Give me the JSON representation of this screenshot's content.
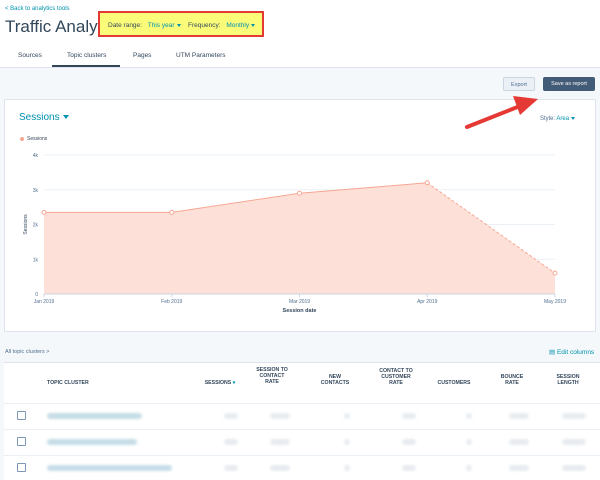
{
  "header": {
    "back_link": "< Back to analytics tools",
    "title": "Traffic Analytics",
    "date_range_label": "Date range:",
    "date_range_value": "This year",
    "frequency_label": "Frequency:",
    "frequency_value": "Monthly"
  },
  "tabs": [
    {
      "label": "Sources"
    },
    {
      "label": "Topic clusters"
    },
    {
      "label": "Pages"
    },
    {
      "label": "UTM Parameters"
    }
  ],
  "actions": {
    "export_label": "Export",
    "save_label": "Save as report"
  },
  "chart_panel": {
    "metric_label": "Sessions",
    "style_label": "Style:",
    "style_value": "Area"
  },
  "chart_data": {
    "type": "area",
    "categories": [
      "Jan 2019",
      "Feb 2019",
      "Mar 2019",
      "Apr 2019",
      "May 2019"
    ],
    "series": [
      {
        "name": "Sessions",
        "values": [
          2350,
          2350,
          2900,
          3200,
          600
        ]
      }
    ],
    "xlabel": "Session date",
    "ylabel": "Sessions",
    "ylim": [
      0,
      4000
    ],
    "yticks": [
      "0",
      "1k",
      "2k",
      "3k",
      "4k"
    ],
    "dashed_last_segment": true,
    "grid": true,
    "legend_position": "top-left",
    "color": "#f6a793"
  },
  "table": {
    "breadcrumb": "All topic clusters >",
    "edit_columns": "Edit columns",
    "columns": [
      {
        "label": "TOPIC CLUSTER"
      },
      {
        "label": "SESSIONS"
      },
      {
        "label": "SESSION TO CONTACT RATE"
      },
      {
        "label": "NEW CONTACTS"
      },
      {
        "label": "CONTACT TO CUSTOMER RATE"
      },
      {
        "label": "CUSTOMERS"
      },
      {
        "label": "BOUNCE RATE"
      },
      {
        "label": "SESSION LENGTH"
      }
    ]
  }
}
